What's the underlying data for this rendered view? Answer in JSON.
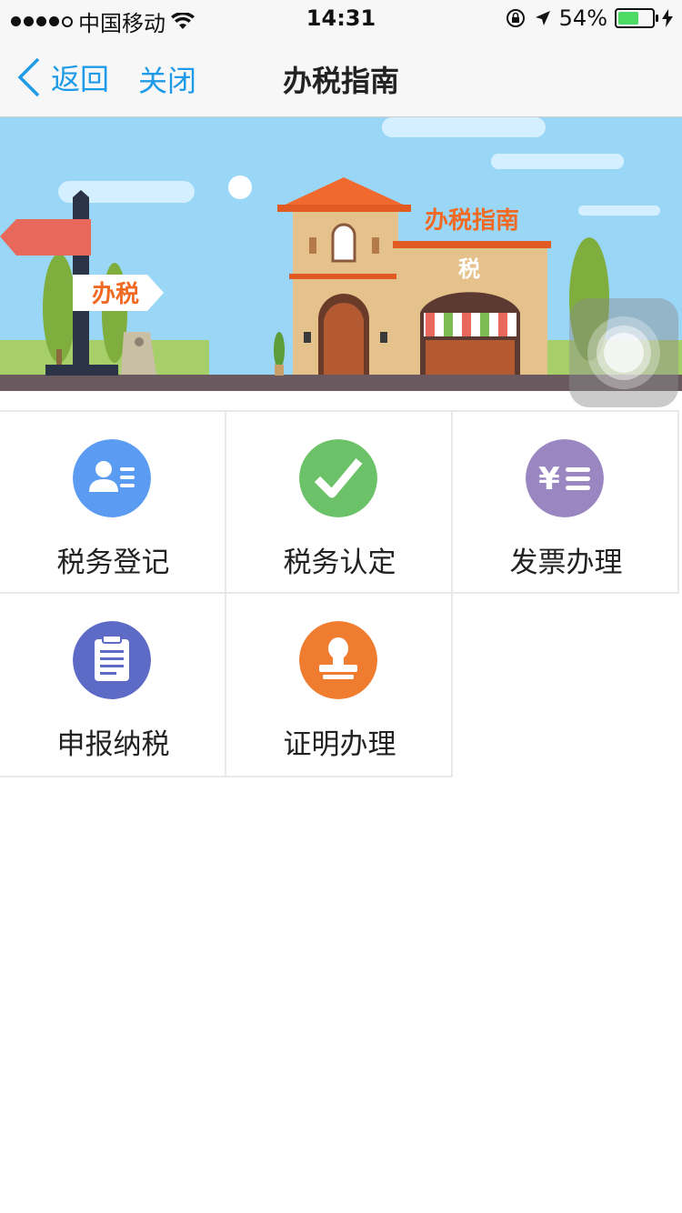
{
  "status_bar": {
    "carrier": "中国移动",
    "time": "14:31",
    "battery_percent": "54%",
    "battery_level": 0.54,
    "icons": [
      "signal-dots-icon",
      "wifi-icon",
      "orientation-lock-icon",
      "location-arrow-icon",
      "battery-icon",
      "charging-bolt-icon"
    ]
  },
  "navbar": {
    "back_label": "返回",
    "close_label": "关闭",
    "title": "办税指南"
  },
  "banner": {
    "sign_text": "办税",
    "building_title": "办税指南",
    "building_sign": "税"
  },
  "menu": [
    {
      "label": "税务登记",
      "icon": "person-card-icon",
      "color": "#5b9cf2"
    },
    {
      "label": "税务认定",
      "icon": "checkmark-icon",
      "color": "#6cc268"
    },
    {
      "label": "发票办理",
      "icon": "yuan-list-icon",
      "color": "#9a86c0"
    },
    {
      "label": "申报纳税",
      "icon": "clipboard-icon",
      "color": "#5d6bc6"
    },
    {
      "label": "证明办理",
      "icon": "stamp-icon",
      "color": "#f07c30"
    }
  ]
}
